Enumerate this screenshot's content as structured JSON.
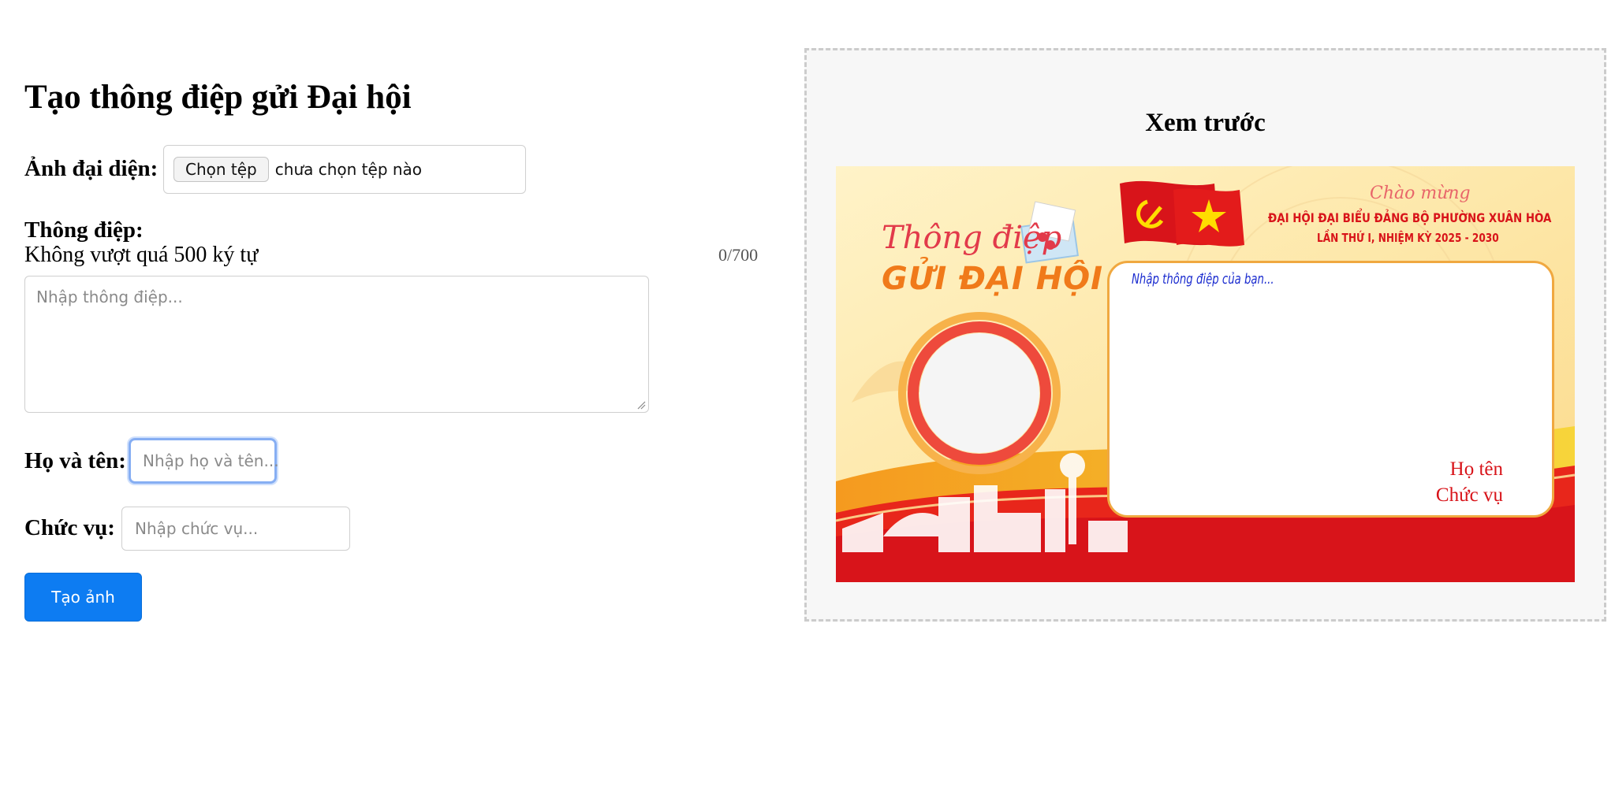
{
  "form": {
    "title": "Tạo thông điệp gửi Đại hội",
    "avatar_label": "Ảnh đại diện:",
    "file_button": "Chọn tệp",
    "file_status": "chưa chọn tệp nào",
    "message_label": "Thông điệp:",
    "message_hint": "Không vượt quá 500 ký tự",
    "message_counter": "0/700",
    "message_placeholder": "Nhập thông điệp...",
    "name_label": "Họ và tên:",
    "name_placeholder": "Nhập họ và tên...",
    "position_label": "Chức vụ:",
    "position_placeholder": "Nhập chức vụ...",
    "generate_button": "Tạo ảnh"
  },
  "preview": {
    "title": "Xem trước",
    "card": {
      "title_line1": "Thông điệp",
      "title_line2": "GỬI ĐẠI HỘI",
      "greeting": "Chào mừng",
      "congress_line1": "ĐẠI HỘI ĐẠI BIỂU ĐẢNG BỘ PHƯỜNG XUÂN HÒA",
      "congress_line2": "LẦN THỨ I, NHIỆM KỲ 2025 - 2030",
      "message_placeholder": "Nhập thông điệp của bạn...",
      "name_placeholder": "Họ tên",
      "position_placeholder": "Chức vụ"
    }
  },
  "colors": {
    "primary_button": "#0d7cf2",
    "focus_ring": "#86aef3",
    "card_red": "#d8141a",
    "card_yellow": "#fde9a6"
  }
}
